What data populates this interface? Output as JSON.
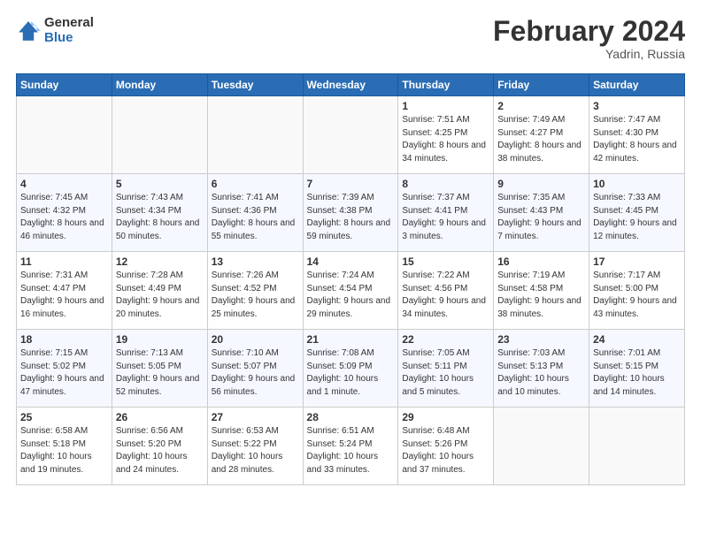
{
  "logo": {
    "general": "General",
    "blue": "Blue"
  },
  "header": {
    "title": "February 2024",
    "subtitle": "Yadrin, Russia"
  },
  "weekdays": [
    "Sunday",
    "Monday",
    "Tuesday",
    "Wednesday",
    "Thursday",
    "Friday",
    "Saturday"
  ],
  "weeks": [
    [
      {
        "day": "",
        "sunrise": "",
        "sunset": "",
        "daylight": ""
      },
      {
        "day": "",
        "sunrise": "",
        "sunset": "",
        "daylight": ""
      },
      {
        "day": "",
        "sunrise": "",
        "sunset": "",
        "daylight": ""
      },
      {
        "day": "",
        "sunrise": "",
        "sunset": "",
        "daylight": ""
      },
      {
        "day": "1",
        "sunrise": "7:51 AM",
        "sunset": "4:25 PM",
        "daylight": "8 hours and 34 minutes."
      },
      {
        "day": "2",
        "sunrise": "7:49 AM",
        "sunset": "4:27 PM",
        "daylight": "8 hours and 38 minutes."
      },
      {
        "day": "3",
        "sunrise": "7:47 AM",
        "sunset": "4:30 PM",
        "daylight": "8 hours and 42 minutes."
      }
    ],
    [
      {
        "day": "4",
        "sunrise": "7:45 AM",
        "sunset": "4:32 PM",
        "daylight": "8 hours and 46 minutes."
      },
      {
        "day": "5",
        "sunrise": "7:43 AM",
        "sunset": "4:34 PM",
        "daylight": "8 hours and 50 minutes."
      },
      {
        "day": "6",
        "sunrise": "7:41 AM",
        "sunset": "4:36 PM",
        "daylight": "8 hours and 55 minutes."
      },
      {
        "day": "7",
        "sunrise": "7:39 AM",
        "sunset": "4:38 PM",
        "daylight": "8 hours and 59 minutes."
      },
      {
        "day": "8",
        "sunrise": "7:37 AM",
        "sunset": "4:41 PM",
        "daylight": "9 hours and 3 minutes."
      },
      {
        "day": "9",
        "sunrise": "7:35 AM",
        "sunset": "4:43 PM",
        "daylight": "9 hours and 7 minutes."
      },
      {
        "day": "10",
        "sunrise": "7:33 AM",
        "sunset": "4:45 PM",
        "daylight": "9 hours and 12 minutes."
      }
    ],
    [
      {
        "day": "11",
        "sunrise": "7:31 AM",
        "sunset": "4:47 PM",
        "daylight": "9 hours and 16 minutes."
      },
      {
        "day": "12",
        "sunrise": "7:28 AM",
        "sunset": "4:49 PM",
        "daylight": "9 hours and 20 minutes."
      },
      {
        "day": "13",
        "sunrise": "7:26 AM",
        "sunset": "4:52 PM",
        "daylight": "9 hours and 25 minutes."
      },
      {
        "day": "14",
        "sunrise": "7:24 AM",
        "sunset": "4:54 PM",
        "daylight": "9 hours and 29 minutes."
      },
      {
        "day": "15",
        "sunrise": "7:22 AM",
        "sunset": "4:56 PM",
        "daylight": "9 hours and 34 minutes."
      },
      {
        "day": "16",
        "sunrise": "7:19 AM",
        "sunset": "4:58 PM",
        "daylight": "9 hours and 38 minutes."
      },
      {
        "day": "17",
        "sunrise": "7:17 AM",
        "sunset": "5:00 PM",
        "daylight": "9 hours and 43 minutes."
      }
    ],
    [
      {
        "day": "18",
        "sunrise": "7:15 AM",
        "sunset": "5:02 PM",
        "daylight": "9 hours and 47 minutes."
      },
      {
        "day": "19",
        "sunrise": "7:13 AM",
        "sunset": "5:05 PM",
        "daylight": "9 hours and 52 minutes."
      },
      {
        "day": "20",
        "sunrise": "7:10 AM",
        "sunset": "5:07 PM",
        "daylight": "9 hours and 56 minutes."
      },
      {
        "day": "21",
        "sunrise": "7:08 AM",
        "sunset": "5:09 PM",
        "daylight": "10 hours and 1 minute."
      },
      {
        "day": "22",
        "sunrise": "7:05 AM",
        "sunset": "5:11 PM",
        "daylight": "10 hours and 5 minutes."
      },
      {
        "day": "23",
        "sunrise": "7:03 AM",
        "sunset": "5:13 PM",
        "daylight": "10 hours and 10 minutes."
      },
      {
        "day": "24",
        "sunrise": "7:01 AM",
        "sunset": "5:15 PM",
        "daylight": "10 hours and 14 minutes."
      }
    ],
    [
      {
        "day": "25",
        "sunrise": "6:58 AM",
        "sunset": "5:18 PM",
        "daylight": "10 hours and 19 minutes."
      },
      {
        "day": "26",
        "sunrise": "6:56 AM",
        "sunset": "5:20 PM",
        "daylight": "10 hours and 24 minutes."
      },
      {
        "day": "27",
        "sunrise": "6:53 AM",
        "sunset": "5:22 PM",
        "daylight": "10 hours and 28 minutes."
      },
      {
        "day": "28",
        "sunrise": "6:51 AM",
        "sunset": "5:24 PM",
        "daylight": "10 hours and 33 minutes."
      },
      {
        "day": "29",
        "sunrise": "6:48 AM",
        "sunset": "5:26 PM",
        "daylight": "10 hours and 37 minutes."
      },
      {
        "day": "",
        "sunrise": "",
        "sunset": "",
        "daylight": ""
      },
      {
        "day": "",
        "sunrise": "",
        "sunset": "",
        "daylight": ""
      }
    ]
  ],
  "labels": {
    "sunrise": "Sunrise:",
    "sunset": "Sunset:",
    "daylight": "Daylight:"
  }
}
